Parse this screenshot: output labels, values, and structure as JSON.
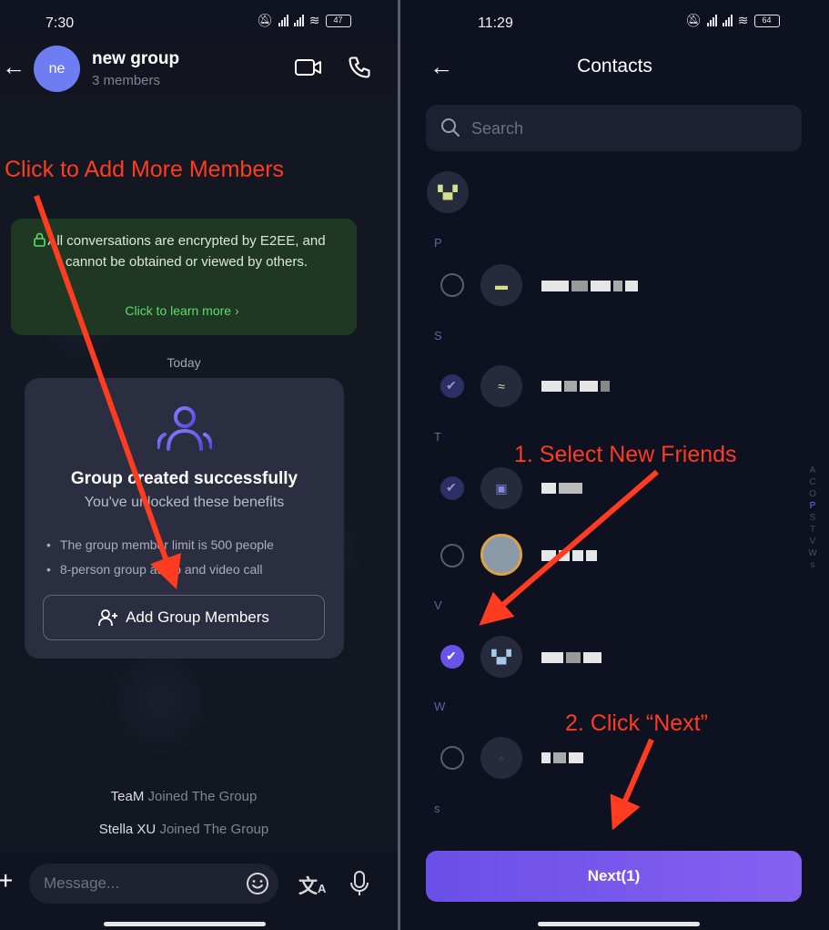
{
  "left": {
    "status": {
      "time": "7:30",
      "battery": "47"
    },
    "header": {
      "avatar_initials": "ne",
      "title": "new group",
      "subtitle": "3 members"
    },
    "annotation": "Click to Add More Members",
    "e2ee": {
      "text": "All conversations are encrypted by E2EE, and cannot be obtained or viewed by others.",
      "link": "Click to learn more ›"
    },
    "date_divider": "Today",
    "card": {
      "icon": "group-icon",
      "title": "Group created successfully",
      "subtitle": "You've unlocked these benefits",
      "benefits": [
        "The group member limit is 500 people",
        "8-person group audio and video call"
      ],
      "button": "Add Group Members"
    },
    "joins": [
      {
        "name": "TeaM",
        "text": "Joined The Group"
      },
      {
        "name": "Stella XU",
        "text": "Joined The Group"
      }
    ],
    "composer": {
      "placeholder": "Message..."
    }
  },
  "right": {
    "status": {
      "time": "11:29",
      "battery": "64"
    },
    "title": "Contacts",
    "search_placeholder": "Search",
    "sections": [
      "P",
      "S",
      "T",
      "V",
      "W",
      "s"
    ],
    "alpha_index": [
      "A",
      "C",
      "O",
      "P",
      "S",
      "T",
      "V",
      "W",
      "s"
    ],
    "alpha_active": "P",
    "annotations": {
      "step1": "1. Select New Friends",
      "step2": "2. Click “Next”"
    },
    "next_button": "Next(1)"
  },
  "colors": {
    "accent": "#6b52e6",
    "annotation": "#ff3b20",
    "link": "#5fdc6a"
  }
}
